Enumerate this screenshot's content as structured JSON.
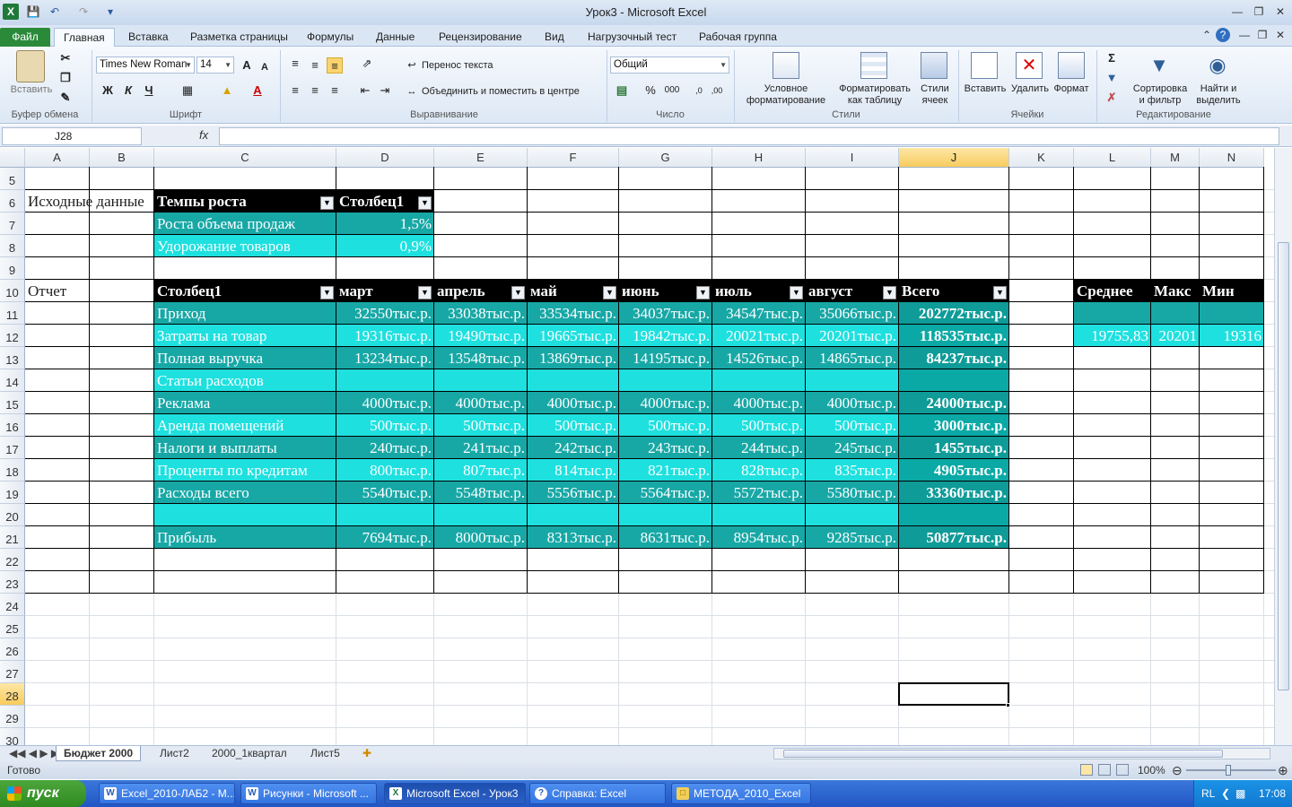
{
  "window": {
    "title": "Урок3 - Microsoft Excel"
  },
  "tabs": {
    "file": "Файл",
    "items": [
      "Главная",
      "Вставка",
      "Разметка страницы",
      "Формулы",
      "Данные",
      "Рецензирование",
      "Вид",
      "Нагрузочный тест",
      "Рабочая группа"
    ]
  },
  "ribbon": {
    "clipboard": {
      "paste": "Вставить",
      "label": "Буфер обмена"
    },
    "font": {
      "name": "Times New Roman",
      "size": "14",
      "bold": "Ж",
      "italic": "К",
      "underline": "Ч",
      "label": "Шрифт"
    },
    "align": {
      "wrap": "Перенос текста",
      "merge": "Объединить и поместить в центре",
      "label": "Выравнивание"
    },
    "number": {
      "format": "Общий",
      "percent": "%",
      "thousands": "000",
      "label": "Число"
    },
    "styles": {
      "cond1": "Условное",
      "cond2": "форматирование",
      "fmt1": "Форматировать",
      "fmt2": "как таблицу",
      "cell1": "Стили",
      "cell2": "ячеек",
      "label": "Стили"
    },
    "cells": {
      "insert": "Вставить",
      "delete": "Удалить",
      "format": "Формат",
      "label": "Ячейки"
    },
    "edit": {
      "sort1": "Сортировка",
      "sort2": "и фильтр",
      "find1": "Найти и",
      "find2": "выделить",
      "label": "Редактирование"
    }
  },
  "formula": {
    "namebox": "J28",
    "fx": "fx",
    "value": ""
  },
  "columns": [
    "A",
    "B",
    "C",
    "D",
    "E",
    "F",
    "G",
    "H",
    "I",
    "J",
    "K",
    "L",
    "M",
    "N"
  ],
  "rows": [
    "5",
    "6",
    "7",
    "8",
    "9",
    "10",
    "11",
    "12",
    "13",
    "14",
    "15",
    "16",
    "17",
    "18",
    "19",
    "20",
    "21",
    "22",
    "23",
    "24",
    "25",
    "26",
    "27",
    "28",
    "29",
    "30"
  ],
  "cells": {
    "A6": "Исходные данные",
    "A10": "Отчет",
    "rates": {
      "h1": "Темпы роста",
      "h2": "Столбец1",
      "rows": [
        [
          "Роста объема продаж",
          "1,5%"
        ],
        [
          "Удорожание товаров",
          "0,9%"
        ]
      ]
    },
    "report": {
      "headers": [
        "Столбец1",
        "март",
        "апрель",
        "май",
        "июнь",
        "июль",
        "август",
        "Всего"
      ],
      "rows": [
        [
          "Приход",
          "32550тыс.р.",
          "33038тыс.р.",
          "33534тыс.р.",
          "34037тыс.р.",
          "34547тыс.р.",
          "35066тыс.р.",
          "202772тыс.р."
        ],
        [
          "Затраты на товар",
          "19316тыс.р.",
          "19490тыс.р.",
          "19665тыс.р.",
          "19842тыс.р.",
          "20021тыс.р.",
          "20201тыс.р.",
          "118535тыс.р."
        ],
        [
          "Полная выручка",
          "13234тыс.р.",
          "13548тыс.р.",
          "13869тыс.р.",
          "14195тыс.р.",
          "14526тыс.р.",
          "14865тыс.р.",
          "84237тыс.р."
        ],
        [
          "Статьи расходов",
          "",
          "",
          "",
          "",
          "",
          "",
          ""
        ],
        [
          "Реклама",
          "4000тыс.р.",
          "4000тыс.р.",
          "4000тыс.р.",
          "4000тыс.р.",
          "4000тыс.р.",
          "4000тыс.р.",
          "24000тыс.р."
        ],
        [
          "Аренда помещений",
          "500тыс.р.",
          "500тыс.р.",
          "500тыс.р.",
          "500тыс.р.",
          "500тыс.р.",
          "500тыс.р.",
          "3000тыс.р."
        ],
        [
          "Налоги и выплаты",
          "240тыс.р.",
          "241тыс.р.",
          "242тыс.р.",
          "243тыс.р.",
          "244тыс.р.",
          "245тыс.р.",
          "1455тыс.р."
        ],
        [
          "Проценты по кредитам",
          "800тыс.р.",
          "807тыс.р.",
          "814тыс.р.",
          "821тыс.р.",
          "828тыс.р.",
          "835тыс.р.",
          "4905тыс.р."
        ],
        [
          "Расходы всего",
          "5540тыс.р.",
          "5548тыс.р.",
          "5556тыс.р.",
          "5564тыс.р.",
          "5572тыс.р.",
          "5580тыс.р.",
          "33360тыс.р."
        ],
        [
          "",
          "",
          "",
          "",
          "",
          "",
          "",
          ""
        ],
        [
          "Прибыль",
          "7694тыс.р.",
          "8000тыс.р.",
          "8313тыс.р.",
          "8631тыс.р.",
          "8954тыс.р.",
          "9285тыс.р.",
          "50877тыс.р."
        ]
      ]
    },
    "stats": {
      "headers": [
        "Среднее",
        "Макс",
        "Мин"
      ],
      "row12": [
        "19755,83",
        "20201",
        "19316"
      ]
    }
  },
  "sheets": [
    "Бюджет 2000",
    "Лист2",
    "2000_1квартал",
    "Лист5"
  ],
  "status": {
    "ready": "Готово",
    "zoom": "100%"
  },
  "taskbar": {
    "start": "пуск",
    "items": [
      "Excel_2010-ЛАБ2 - M...",
      "Рисунки - Microsoft ...",
      "Microsoft Excel - Урок3",
      "Справка: Excel",
      "МЕТОДА_2010_Excel"
    ],
    "lang": "RL",
    "time": "17:08"
  }
}
